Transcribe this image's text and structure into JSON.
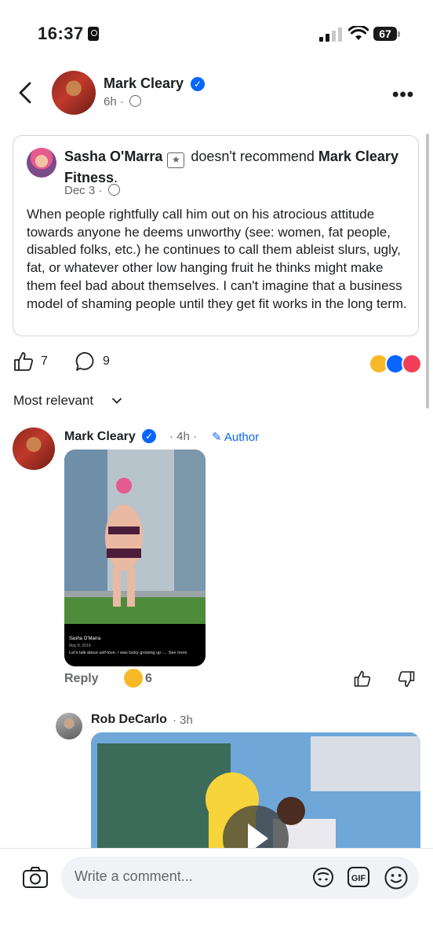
{
  "status_bar": {
    "time": "16:37",
    "battery": "67"
  },
  "post": {
    "author": "Mark Cleary",
    "time": "6h",
    "separator": "·"
  },
  "recommendation": {
    "reviewer": "Sasha O'Marra",
    "verb": "doesn't recommend",
    "page": "Mark Cleary Fitness",
    "date": "Dec 3",
    "separator": "·",
    "body": "When people rightfully call him out on his atrocious attitude towards anyone he deems unworthy (see: women, fat people, disabled folks, etc.) he continues to call them ableist slurs, ugly, fat, or whatever other low hanging fruit he thinks might make them feel bad about themselves. I can't imagine that a business model of shaming people until they get fit works in the long term."
  },
  "stats": {
    "likes": "7",
    "comments": "9"
  },
  "sort": {
    "label": "Most relevant"
  },
  "comment": {
    "author": "Mark Cleary",
    "time": "· 4h ·",
    "badge": "Author",
    "reply_label": "Reply",
    "reaction_count": "6",
    "embedded_post": {
      "name": "Sasha O'Marra",
      "date": "May 8, 2019 ·",
      "text": "Let's talk about self-love. I was lucky growing up -... See more"
    }
  },
  "reply": {
    "author": "Rob DeCarlo",
    "time": "· 3h"
  },
  "composer": {
    "placeholder": "Write a comment..."
  },
  "colors": {
    "accent": "#0866ff",
    "muted": "#65676b",
    "text": "#1c1e21"
  }
}
